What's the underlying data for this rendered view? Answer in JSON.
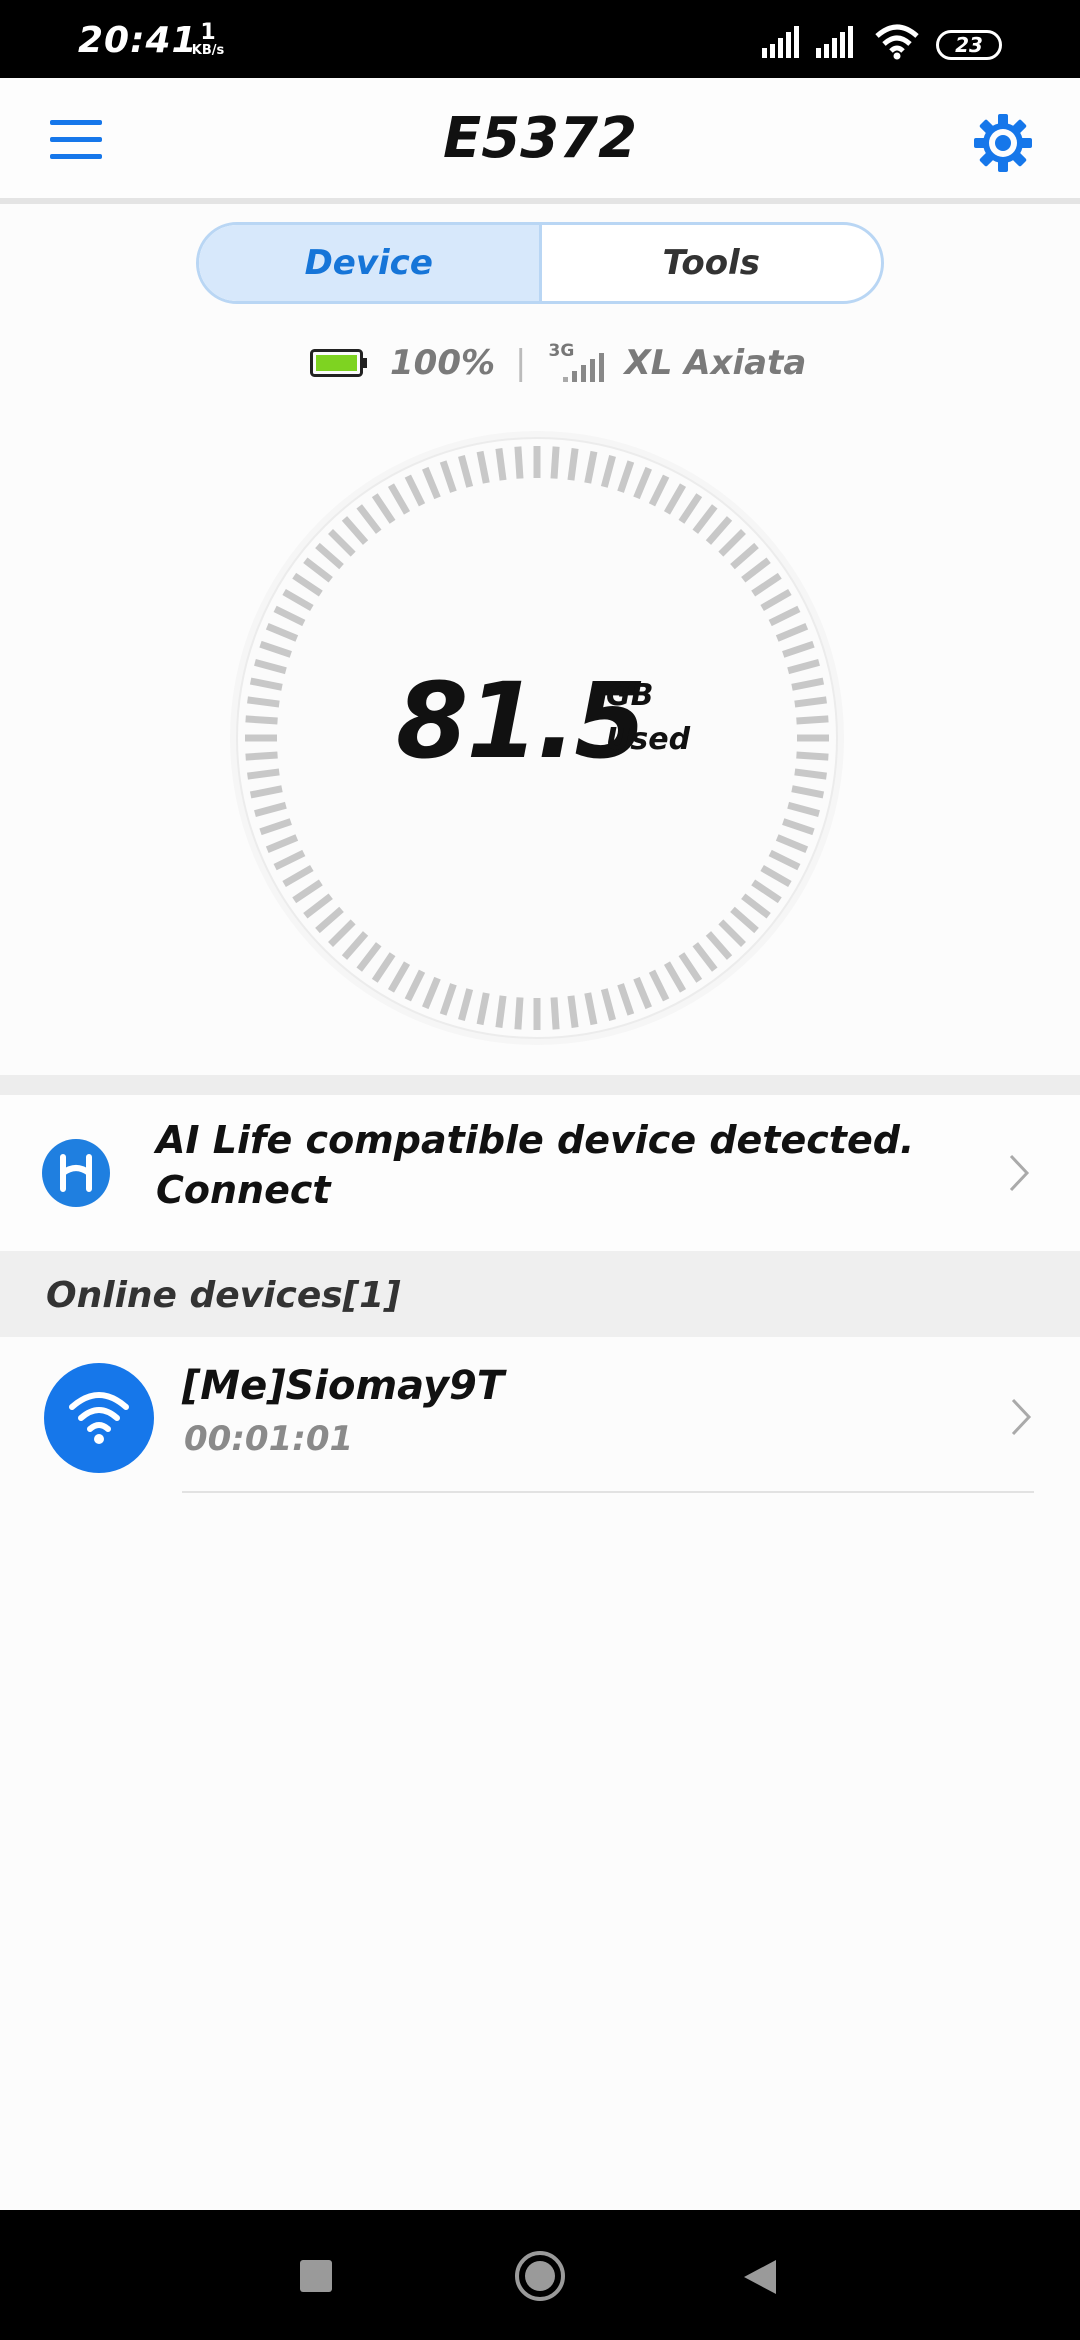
{
  "status_bar": {
    "time": "20:41",
    "speed_value": "1",
    "speed_unit": "KB/s",
    "battery": "23"
  },
  "app_bar": {
    "title": "E5372",
    "menu_icon": "hamburger-menu-icon",
    "settings_icon": "gear-icon"
  },
  "tabs": [
    {
      "label": "Device",
      "selected": true
    },
    {
      "label": "Tools",
      "selected": false
    }
  ],
  "device_info": {
    "battery_level": "100%",
    "separator": "|",
    "network_type": "3G",
    "operator": "XL Axiata"
  },
  "usage": {
    "value": "81.5",
    "unit": "GB",
    "label": "Used"
  },
  "ai_life": {
    "text": "AI Life compatible device detected. Connect",
    "icon": "ai-life-logo-icon"
  },
  "online_devices": {
    "header": "Online devices[1]",
    "items": [
      {
        "name": "[Me]Siomay9T",
        "duration": "00:01:01",
        "icon": "wifi-icon"
      }
    ]
  },
  "colors": {
    "accent": "#1677ea",
    "tab_selected_bg": "#d7e8fb",
    "battery_green": "#7ed321"
  }
}
